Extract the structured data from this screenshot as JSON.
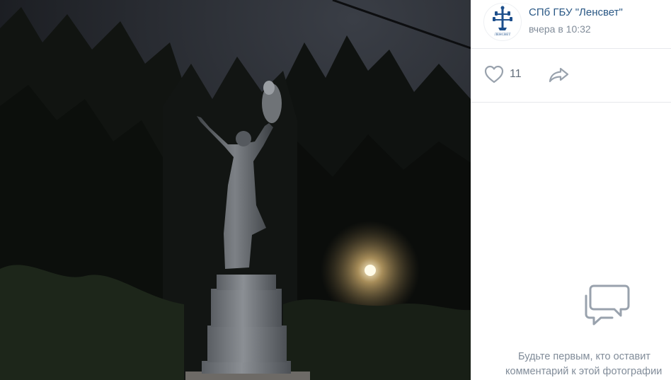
{
  "post": {
    "author": "СПб ГБУ \"Ленсвет\"",
    "time": "вчера в 10:32",
    "avatar_text": "ЛЕНСВЕТ"
  },
  "actions": {
    "likes": "11",
    "like_icon": "heart-icon",
    "share_icon": "share-arrow-icon"
  },
  "comments": {
    "empty_line1": "Будьте первым, кто оставит",
    "empty_line2": "комментарий к этой фотографии",
    "icon": "speech-bubbles-icon"
  },
  "colors": {
    "link": "#2a5885",
    "muted": "#818c99",
    "icon": "#99a2ad",
    "brand": "#1d4f8c"
  }
}
